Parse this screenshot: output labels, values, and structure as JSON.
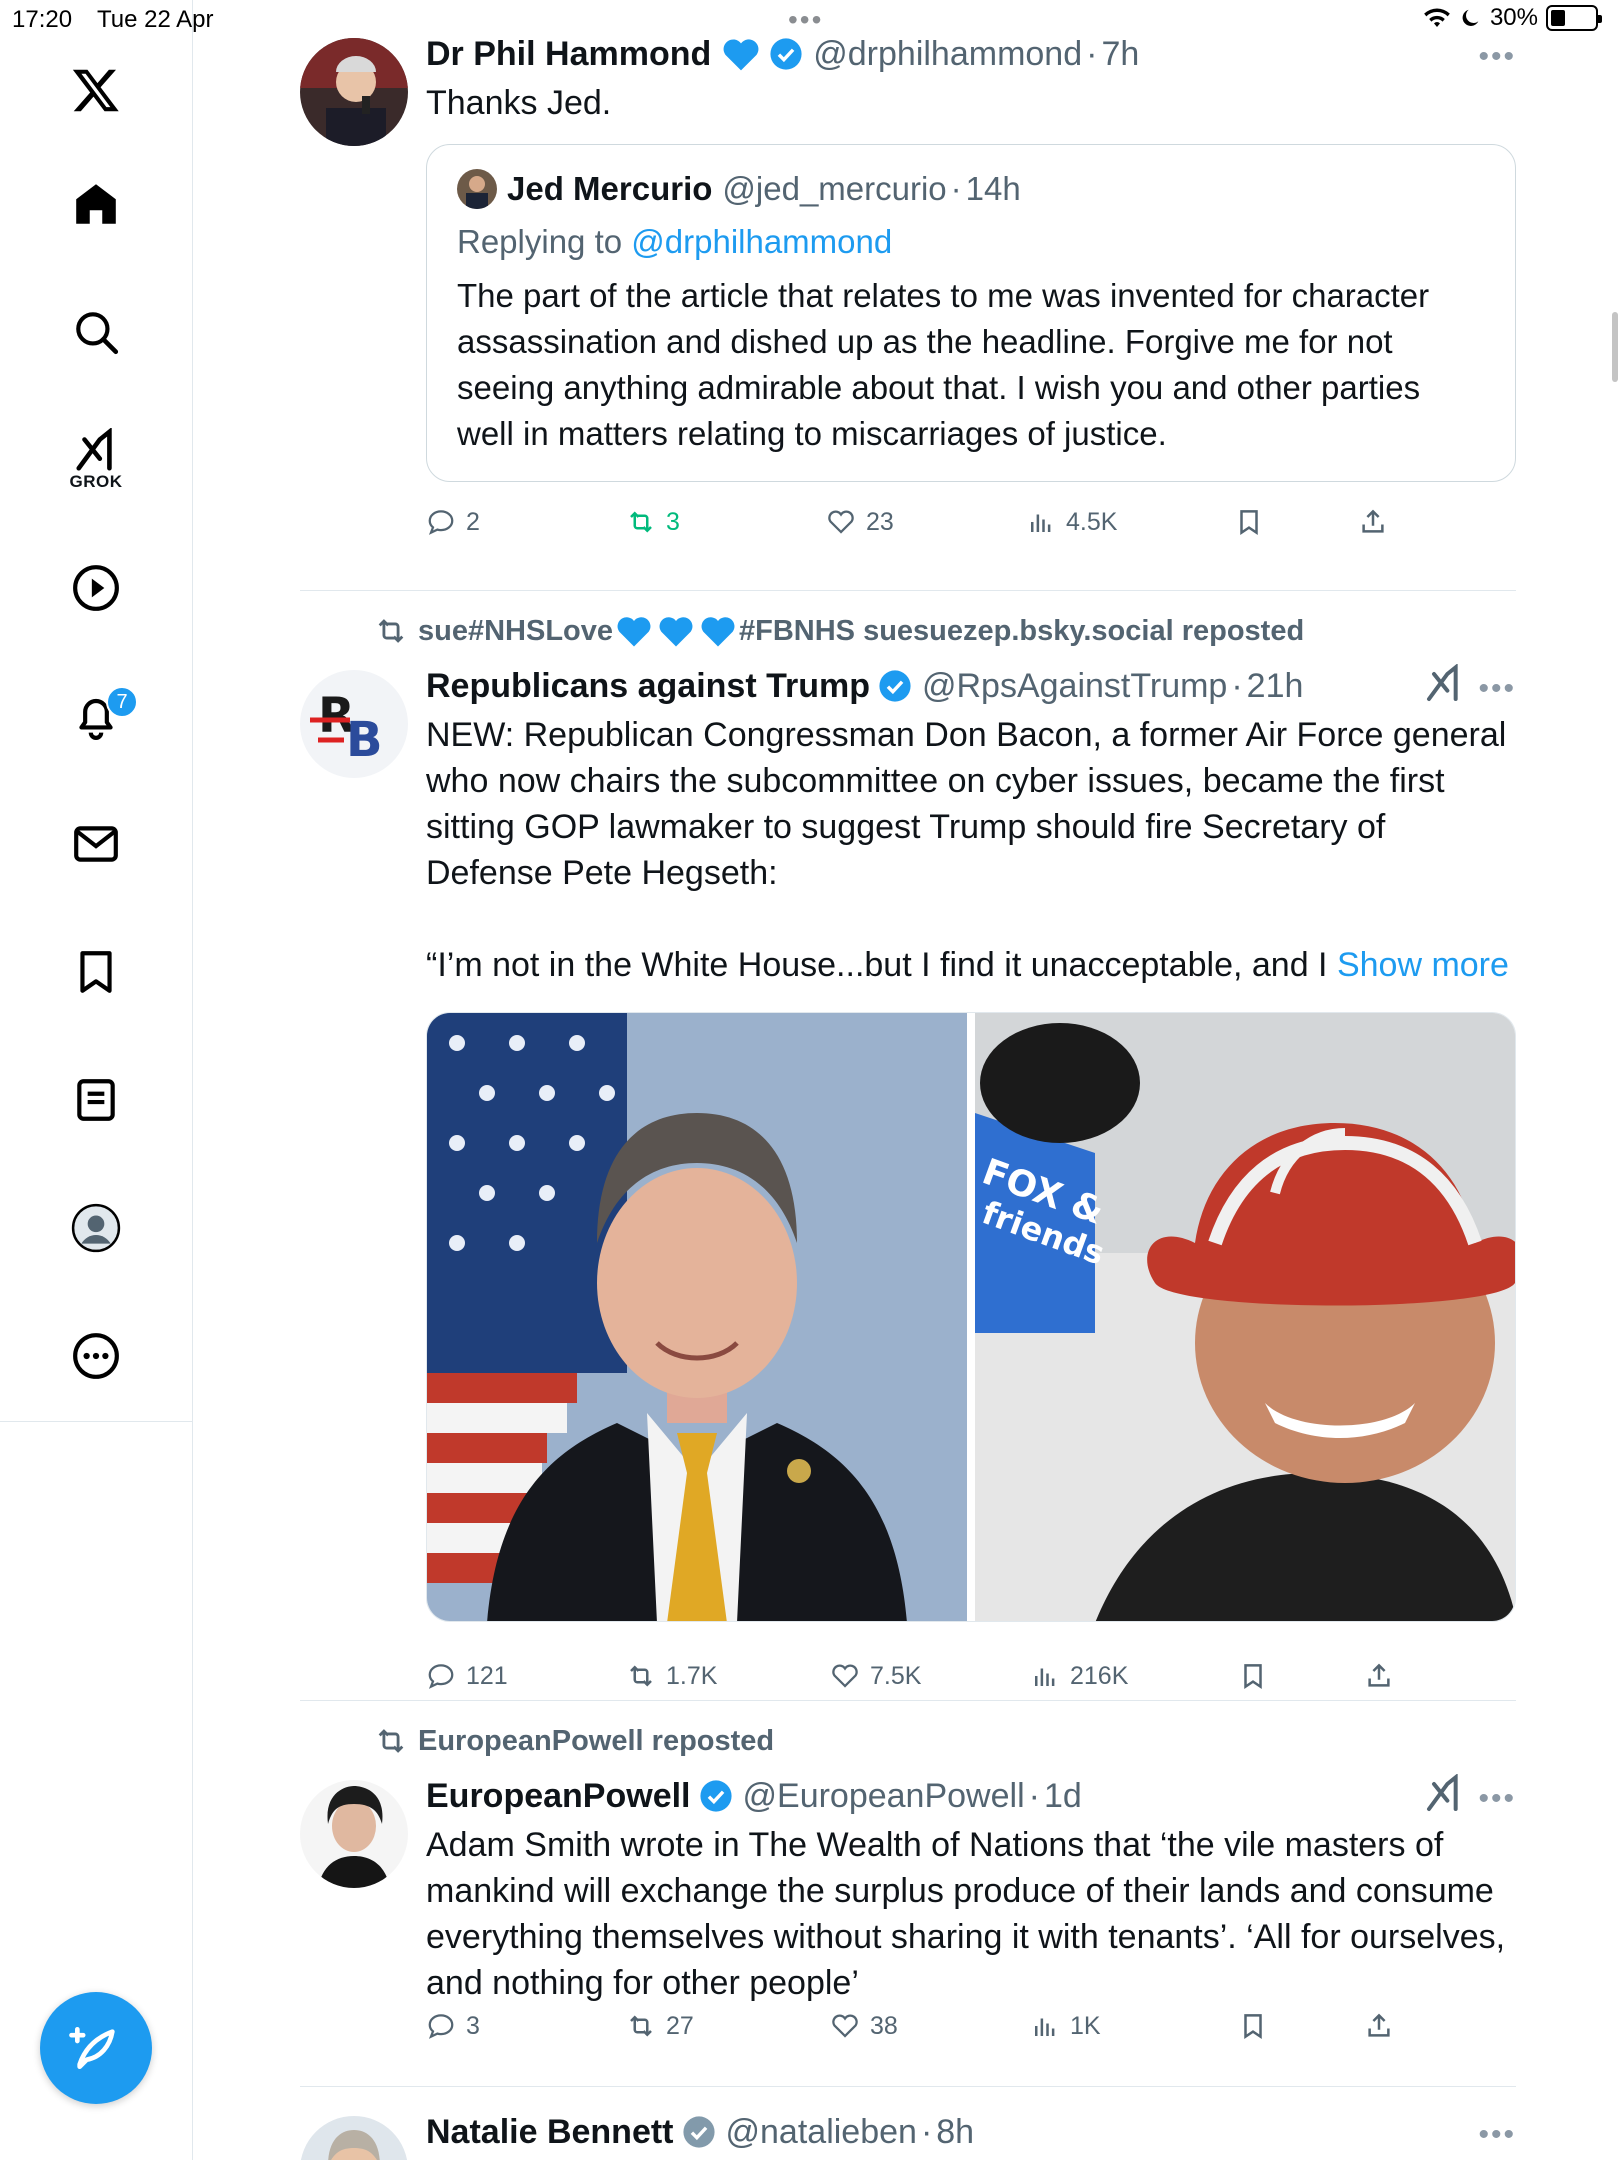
{
  "status_bar": {
    "time": "17:20",
    "date": "Tue 22 Apr",
    "battery": "30%"
  },
  "sidebar": {
    "items": [
      {
        "name": "x-logo"
      },
      {
        "name": "home"
      },
      {
        "name": "explore"
      },
      {
        "name": "grok",
        "label": "GROK"
      },
      {
        "name": "video"
      },
      {
        "name": "notifications",
        "badge": "7"
      },
      {
        "name": "messages"
      },
      {
        "name": "bookmarks"
      },
      {
        "name": "lists"
      },
      {
        "name": "profile"
      },
      {
        "name": "more"
      }
    ]
  },
  "tweets": [
    {
      "name": "Dr Phil Hammond",
      "handle": "@drphilhammond",
      "time": "7h",
      "text": "Thanks Jed.",
      "quote": {
        "name": "Jed Mercurio",
        "handle": "@jed_mercurio",
        "time": "14h",
        "replying_prefix": "Replying to ",
        "replying_to": "@drphilhammond",
        "text": "The part of the article that relates to me was invented for character assassination and dished up as the headline. Forgive me for not seeing anything admirable about that. I wish you and other parties well in matters relating to miscarriages of justice."
      },
      "stats": {
        "replies": "2",
        "reposts": "3",
        "likes": "23",
        "views": "4.5K"
      }
    },
    {
      "reposted_by_a": "sue#NHSLove",
      "reposted_by_b": "#FBNHS suesuezep.bsky.social reposted",
      "name": "Republicans against Trump",
      "handle": "@RpsAgainstTrump",
      "time": "21h",
      "text": "NEW: Republican Congressman Don Bacon, a former Air Force general who now chairs the subcommittee on cyber issues, became the first sitting GOP lawmaker to suggest Trump should fire Secretary of Defense Pete Hegseth:",
      "text2": "“I’m not in the White House...but I find it unacceptable, and I ",
      "show_more": "Show more",
      "stats": {
        "replies": "121",
        "reposts": "1.7K",
        "likes": "7.5K",
        "views": "216K"
      }
    },
    {
      "reposted_by": "EuropeanPowell reposted",
      "name": "EuropeanPowell",
      "handle": "@EuropeanPowell",
      "time": "1d",
      "text": "Adam Smith wrote in The Wealth of Nations that ‘the vile masters of mankind will exchange the surplus produce of their lands and consume everything themselves without sharing it with tenants’. ‘All for ourselves, and nothing for other people’",
      "stats": {
        "replies": "3",
        "reposts": "27",
        "likes": "38",
        "views": "1K"
      }
    },
    {
      "name": "Natalie Bennett",
      "handle": "@natalieben",
      "time": "8h"
    }
  ],
  "colors": {
    "accent": "#1d9bf0",
    "repost_green": "#00ba7c",
    "text": "#0f1419",
    "secondary": "#536471"
  }
}
